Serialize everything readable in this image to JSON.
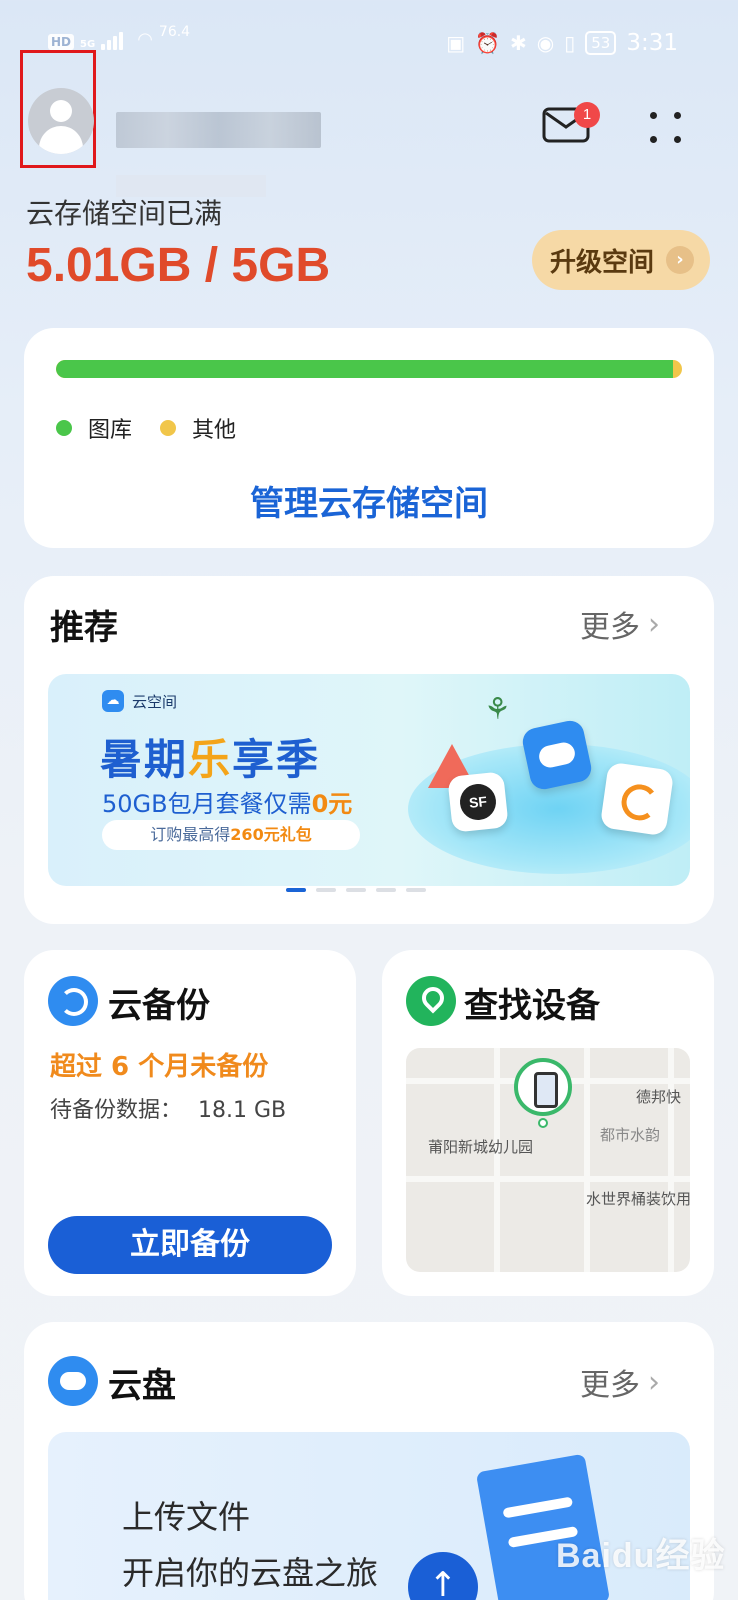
{
  "status_bar": {
    "hd": "HD",
    "network": "5G",
    "speed": "76.4",
    "battery": "53",
    "time": "3:31"
  },
  "header": {
    "mail_badge": "1"
  },
  "storage": {
    "status": "云存储空间已满",
    "usage": "5.01GB / 5GB",
    "upgrade_label": "升级空间",
    "gallery_fraction": 0.985,
    "legend": [
      "图库",
      "其他"
    ],
    "colors": {
      "gallery": "#4ac64a",
      "other": "#f1c64a"
    },
    "manage_label": "管理云存储空间"
  },
  "recommend": {
    "title": "推荐",
    "more": "更多",
    "banner": {
      "logo": "云空间",
      "title_a": "暑期",
      "title_hl": "乐",
      "title_b": "享季",
      "sub_a": "50GB包月套餐仅需",
      "sub_hl": "0元",
      "pill_a": "订购最高得",
      "pill_hl": "260元礼包"
    },
    "pager_count": 5,
    "pager_active": 0
  },
  "backup": {
    "title": "云备份",
    "warning": "超过 6 个月未备份",
    "pending_label": "待备份数据：",
    "pending_value": "18.1 GB",
    "button": "立即备份"
  },
  "find_device": {
    "title": "查找设备",
    "map_labels": [
      "德邦快",
      "莆阳新城幼儿园",
      "都市水韵",
      "水世界桶装饮用"
    ]
  },
  "drive": {
    "title": "云盘",
    "more": "更多",
    "line1": "上传文件",
    "line2": "开启你的云盘之旅"
  },
  "watermark": "Baidu经验"
}
